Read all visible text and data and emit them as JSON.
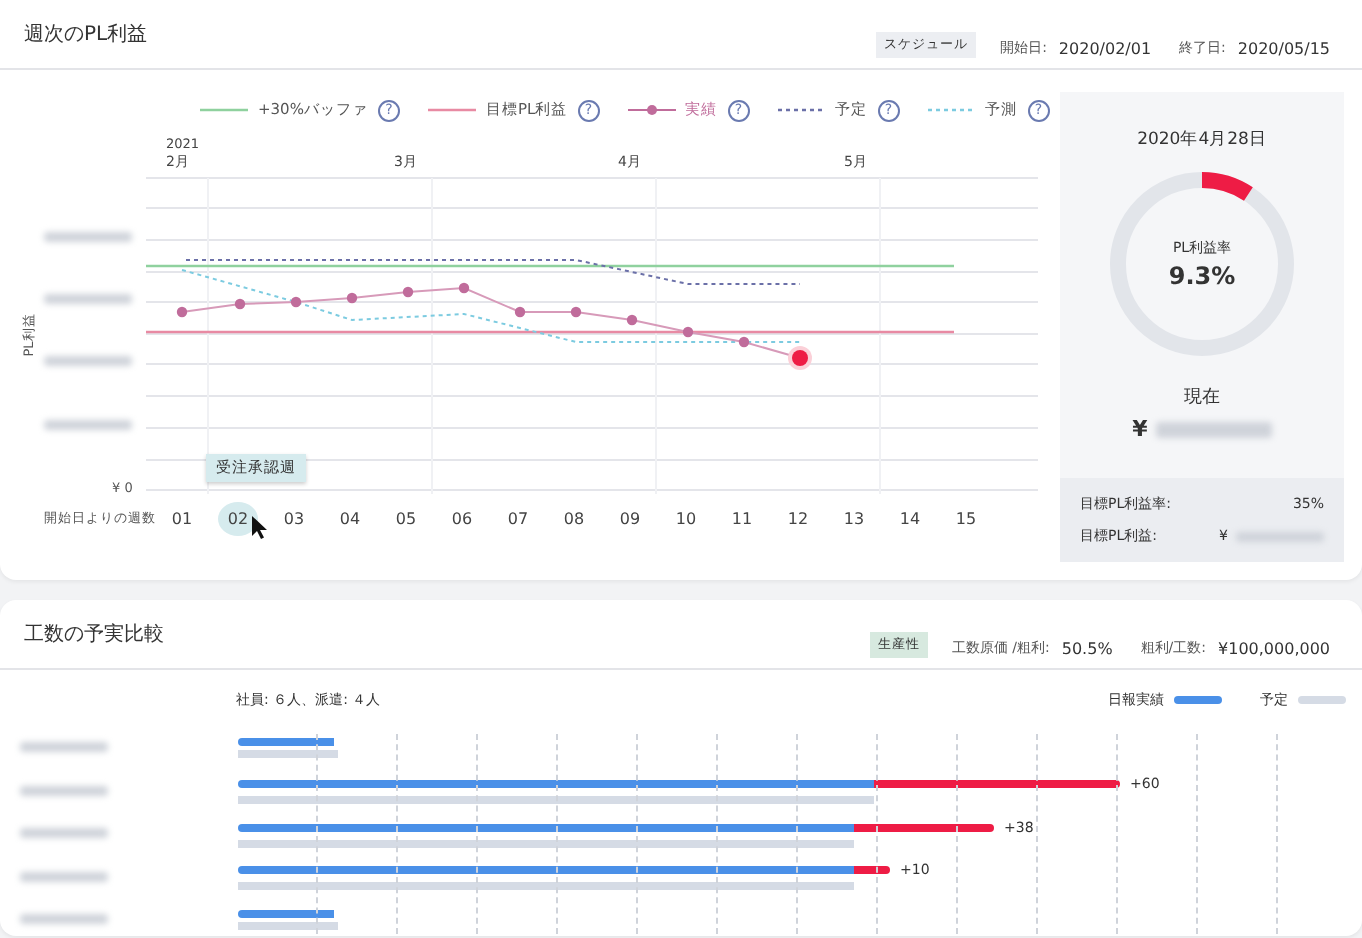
{
  "pl_card": {
    "title": "週次のPL利益",
    "badge": "スケジュール",
    "start_label": "開始日:",
    "start_date": "2020/02/01",
    "end_label": "終了日:",
    "end_date": "2020/05/15",
    "legend": [
      {
        "kind": "solid",
        "color": "#8fd19e",
        "label": "+30%バッファ",
        "help": "?"
      },
      {
        "kind": "solid",
        "color": "#e88aa3",
        "label": "目標PL利益",
        "help": "?"
      },
      {
        "kind": "marker",
        "color": "#c06c9b",
        "label": "実績",
        "help": "?"
      },
      {
        "kind": "dotted",
        "color": "#6b70a8",
        "label": "予定",
        "help": "?"
      },
      {
        "kind": "dotted",
        "color": "#7ccbe0",
        "label": "予測",
        "help": "?"
      }
    ],
    "chart": {
      "year": "2021",
      "months": [
        "2月",
        "3月",
        "4月",
        "5月"
      ],
      "y_title": "PL利益",
      "y_zero": "¥ 0",
      "x_title": "開始日よりの週数",
      "weeks": [
        {
          "label": "01",
          "selected": false
        },
        {
          "label": "02",
          "selected": true
        },
        {
          "label": "03",
          "selected": false
        },
        {
          "label": "04",
          "selected": false
        },
        {
          "label": "05",
          "selected": false
        },
        {
          "label": "06",
          "selected": false
        },
        {
          "label": "07",
          "selected": false
        },
        {
          "label": "08",
          "selected": false
        },
        {
          "label": "09",
          "selected": false
        },
        {
          "label": "10",
          "selected": false
        },
        {
          "label": "11",
          "selected": false
        },
        {
          "label": "12",
          "selected": false
        },
        {
          "label": "13",
          "selected": false
        },
        {
          "label": "14",
          "selected": false
        },
        {
          "label": "15",
          "selected": false
        }
      ],
      "tooltip": "受注承認週"
    },
    "summary": {
      "date": "2020年4月28日",
      "gauge_label": "PL利益率",
      "gauge_value": "9.3%",
      "level": 0.093,
      "current_label": "現在",
      "currency": "¥",
      "target_rate_label": "目標PL利益率:",
      "target_rate": "35%",
      "target_profit_label": "目標PL利益:",
      "target_currency": "¥"
    }
  },
  "hours_card": {
    "title": "工数の予実比較",
    "badge": "生産性",
    "cost_label": "工数原価 /粗利:",
    "cost_value": "50.5%",
    "profit_label": "粗利/工数:",
    "profit_value": "¥100,000,000",
    "staff": "社員: ６人、派遣: ４人",
    "legend": [
      {
        "kind": "actual",
        "label": "日報実績"
      },
      {
        "kind": "plan",
        "label": "予定"
      }
    ],
    "rows": [
      {
        "kind": "plain"
      },
      {
        "kind": "over",
        "diff": "+60"
      },
      {
        "kind": "over",
        "diff": "+38"
      },
      {
        "kind": "over",
        "diff": "+10"
      },
      {
        "kind": "plain"
      }
    ]
  }
}
